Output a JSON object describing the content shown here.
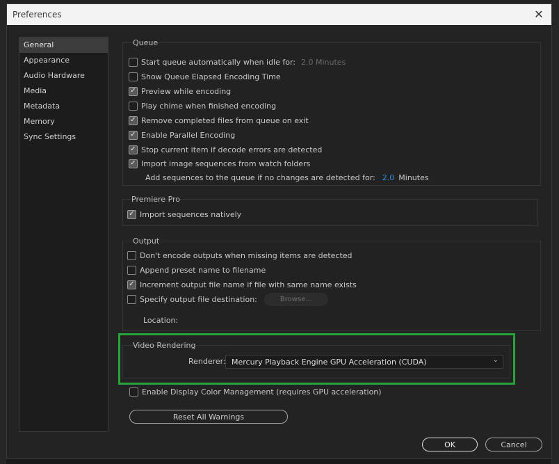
{
  "window": {
    "title": "Preferences"
  },
  "sidebar": {
    "items": [
      {
        "label": "General"
      },
      {
        "label": "Appearance"
      },
      {
        "label": "Audio Hardware"
      },
      {
        "label": "Media"
      },
      {
        "label": "Metadata"
      },
      {
        "label": "Memory"
      },
      {
        "label": "Sync Settings"
      }
    ]
  },
  "queue": {
    "title": "Queue",
    "start_auto_label": "Start queue automatically when idle for:",
    "start_auto_value": "2.0 Minutes",
    "show_elapsed_label": "Show Queue Elapsed Encoding Time",
    "preview_label": "Preview while encoding",
    "chime_label": "Play chime when finished encoding",
    "remove_completed_label": "Remove completed files from queue on exit",
    "parallel_label": "Enable Parallel Encoding",
    "stop_decode_label": "Stop current item if decode errors are detected",
    "import_sequences_label": "Import image sequences from watch folders",
    "add_sequences_label": "Add sequences to the queue if no changes are detected for:",
    "add_sequences_value": "2.0",
    "add_sequences_unit": "Minutes"
  },
  "premiere": {
    "title": "Premiere Pro",
    "import_native_label": "Import sequences natively"
  },
  "output": {
    "title": "Output",
    "dont_encode_label": "Don't encode outputs when missing items are detected",
    "append_preset_label": "Append preset name to filename",
    "increment_label": "Increment output file name if file with same name exists",
    "specify_dest_label": "Specify output file destination:",
    "browse_label": "Browse...",
    "location_label": "Location:"
  },
  "video_rendering": {
    "title": "Video Rendering",
    "renderer_label": "Renderer:",
    "renderer_value": "Mercury Playback Engine GPU Acceleration (CUDA)"
  },
  "display_color_label": "Enable Display Color Management (requires GPU acceleration)",
  "reset_warnings_label": "Reset All Warnings",
  "ok_label": "OK",
  "cancel_label": "Cancel",
  "colors": {
    "highlight": "#27a33a",
    "accent_value": "#2f8fe0"
  }
}
